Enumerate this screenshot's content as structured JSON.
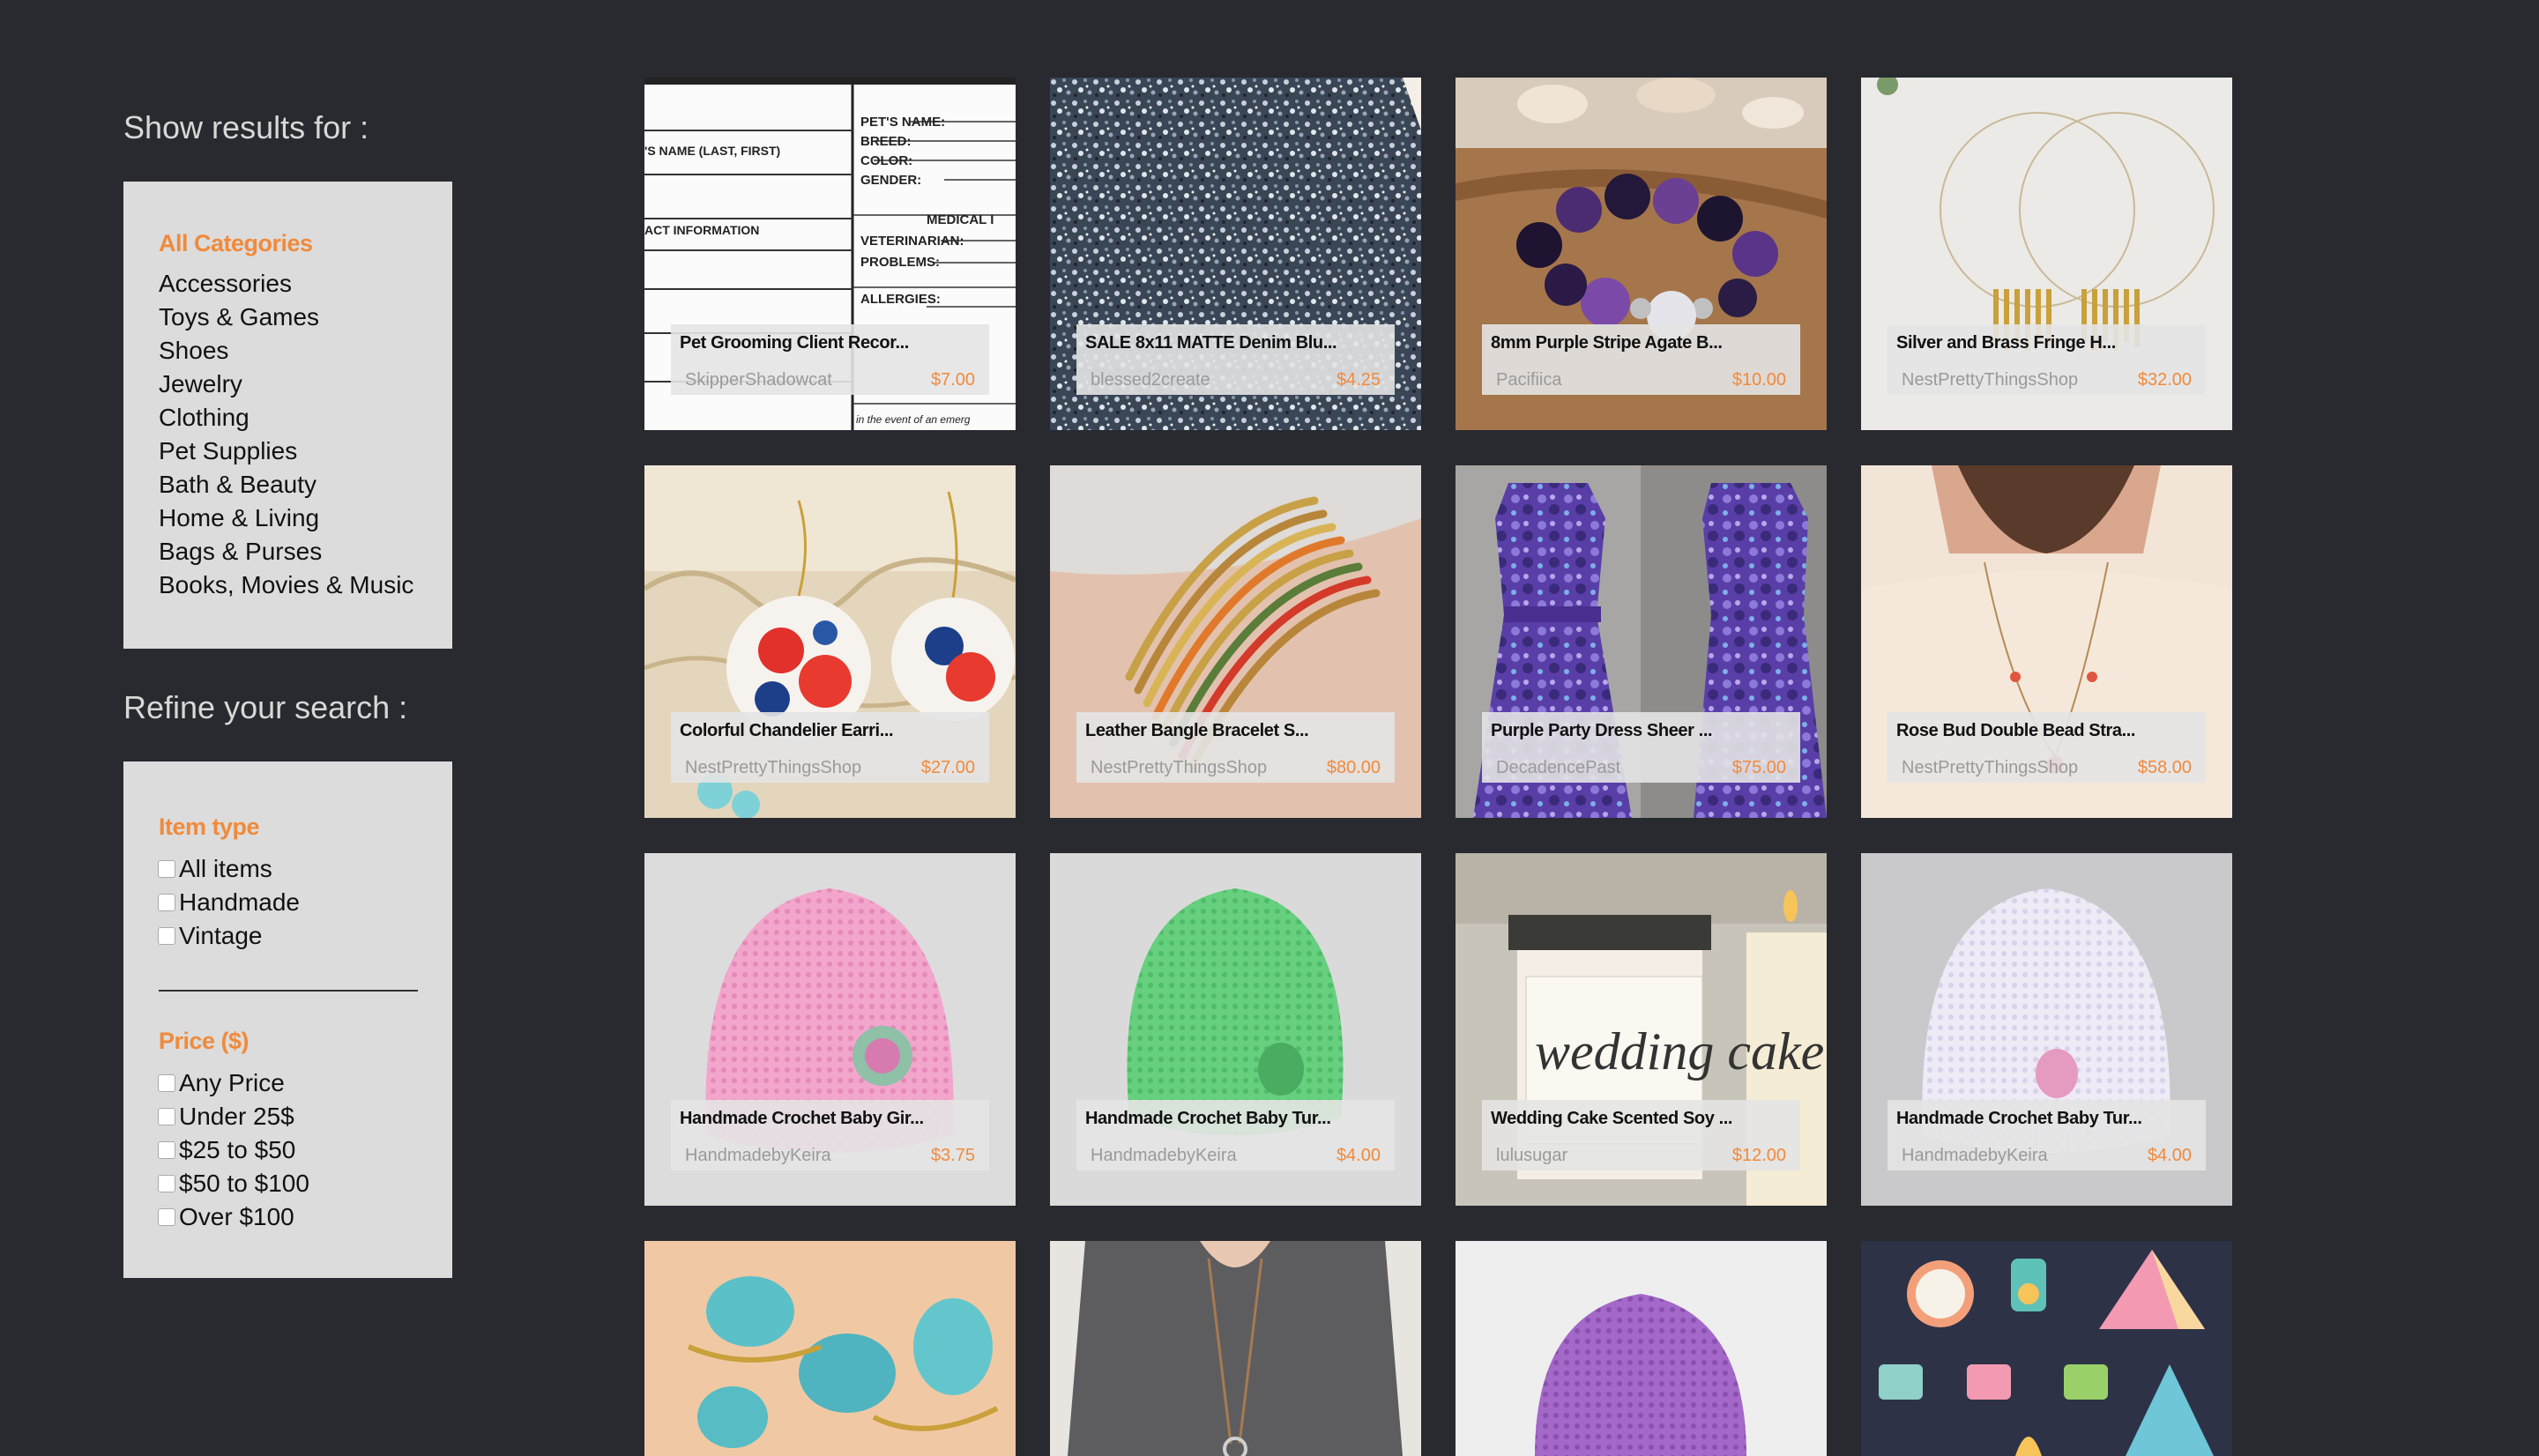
{
  "sidebar": {
    "show_results_title": "Show results for :",
    "categories_head": "All Categories",
    "categories": [
      "Accessories",
      "Toys & Games",
      "Shoes",
      "Jewelry",
      "Clothing",
      "Pet Supplies",
      "Bath & Beauty",
      "Home & Living",
      "Bags & Purses",
      "Books, Movies & Music"
    ],
    "refine_title": "Refine your search :",
    "item_type_head": "Item type",
    "item_types": [
      "All items",
      "Handmade",
      "Vintage"
    ],
    "price_head": "Price ($)",
    "prices": [
      "Any Price",
      "Under 25$",
      "$25 to $50",
      "$50 to $100",
      "Over $100"
    ]
  },
  "products": [
    {
      "title": "Pet Grooming Client Recor...",
      "shop": "SkipperShadowcat",
      "price": "$7.00",
      "image": "pet-form"
    },
    {
      "title": "SALE 8x11 MATTE Denim Blu...",
      "shop": "blessed2create",
      "price": "$4.25",
      "image": "glitter"
    },
    {
      "title": "8mm Purple Stripe Agate B...",
      "shop": "Pacifiica",
      "price": "$10.00",
      "image": "bracelet"
    },
    {
      "title": "Silver and Brass Fringe H...",
      "shop": "NestPrettyThingsShop",
      "price": "$32.00",
      "image": "hoops"
    },
    {
      "title": "Colorful Chandelier Earri...",
      "shop": "NestPrettyThingsShop",
      "price": "$27.00",
      "image": "earrings"
    },
    {
      "title": "Leather Bangle Bracelet S...",
      "shop": "NestPrettyThingsShop",
      "price": "$80.00",
      "image": "bangles"
    },
    {
      "title": "Purple Party Dress Sheer ...",
      "shop": "DecadencePast",
      "price": "$75.00",
      "image": "dress"
    },
    {
      "title": "Rose Bud Double Bead Stra...",
      "shop": "NestPrettyThingsShop",
      "price": "$58.00",
      "image": "necklace"
    },
    {
      "title": "Handmade Crochet Baby Gir...",
      "shop": "HandmadebyKeira",
      "price": "$3.75",
      "image": "pink-hat"
    },
    {
      "title": "Handmade Crochet Baby Tur...",
      "shop": "HandmadebyKeira",
      "price": "$4.00",
      "image": "green-hat"
    },
    {
      "title": "Wedding Cake Scented Soy ...",
      "shop": "lulusugar",
      "price": "$12.00",
      "image": "candle"
    },
    {
      "title": "Handmade Crochet Baby Tur...",
      "shop": "HandmadebyKeira",
      "price": "$4.00",
      "image": "white-hat"
    },
    {
      "title": "",
      "shop": "",
      "price": "",
      "image": "turquoise-rings"
    },
    {
      "title": "",
      "shop": "",
      "price": "",
      "image": "pendant"
    },
    {
      "title": "",
      "shop": "",
      "price": "",
      "image": "purple-hat"
    },
    {
      "title": "",
      "shop": "",
      "price": "",
      "image": "camping-pattern"
    }
  ],
  "image_text": {
    "pet_form": [
      "PET'S NAME:",
      "BREED:",
      "COLOR:",
      "GENDER:",
      "MEDICAL I",
      "VETERINARIAN:",
      "PROBLEMS:",
      "ALLERGIES:",
      "'S NAME (LAST, FIRST)",
      "ACT INFORMATION",
      "in the event of an emerg"
    ],
    "candle": "wedding cake"
  },
  "colors": {
    "accent": "#f08a3c",
    "background": "#282a2f",
    "panel": "#dcdcdc"
  }
}
